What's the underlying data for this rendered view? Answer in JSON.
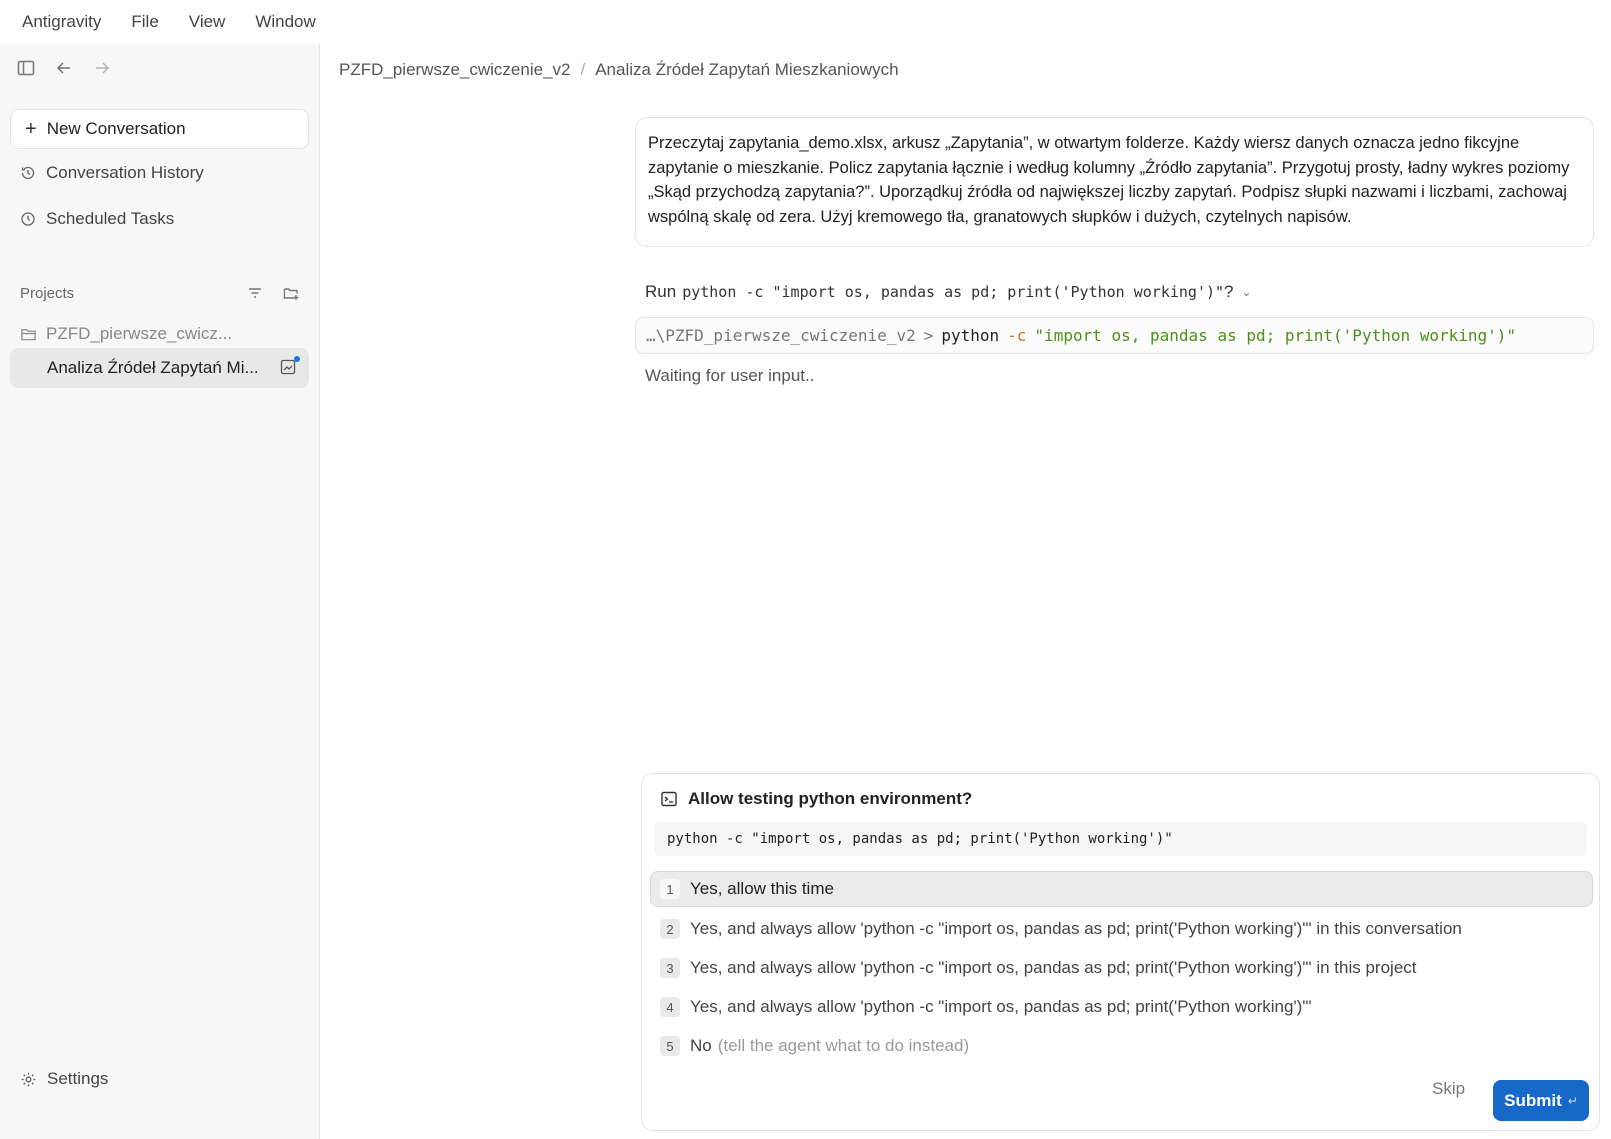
{
  "menubar": {
    "items": [
      "Antigravity",
      "File",
      "View",
      "Window"
    ]
  },
  "sidebar": {
    "toggle_icon": "sidebar-toggle-icon",
    "back_icon": "arrow-left-icon",
    "forward_icon": "arrow-right-icon",
    "new_conversation": "New Conversation",
    "links": [
      {
        "label": "Conversation History",
        "icon": "history-icon"
      },
      {
        "label": "Scheduled Tasks",
        "icon": "clock-icon"
      }
    ],
    "projects_label": "Projects",
    "project_folder": "PZFD_pierwsze_cwicz...",
    "active_conversation": "Analiza Źródeł Zapytań Mi...",
    "settings_label": "Settings"
  },
  "breadcrumb": {
    "project": "PZFD_pierwsze_cwiczenie_v2",
    "separator": "/",
    "conversation": "Analiza Źródeł Zapytań Mieszkaniowych"
  },
  "user_message": {
    "text": "Przeczytaj zapytania_demo.xlsx, arkusz „Zapytania”, w otwartym folderze. Każdy wiersz danych oznacza jedno fikcyjne zapytanie o mieszkanie. Policz zapytania łącznie i według kolumny „Źródło zapytania”. Przygotuj prosty, ładny wykres poziomy „Skąd przychodzą zapytania?”. Uporządkuj źródła od największej liczby zapytań. Podpisz słupki nazwami i liczbami, zachowaj wspólną skalę od zera. Użyj kremowego tła, granatowych słupków i dużych, czytelnych napisów."
  },
  "run_prompt": {
    "prefix": "Run",
    "command": "python -c \"import os, pandas as pd; print('Python working')\"",
    "suffix": "?"
  },
  "terminal": {
    "path": "…\\PZFD_pierwsze_cwiczenie_v2",
    "prompt": ">",
    "program": "python",
    "flag": "-c",
    "argument": "\"import os, pandas as pd; print('Python working')\""
  },
  "status": {
    "waiting": "Waiting for user input.."
  },
  "permission": {
    "icon": "terminal-icon",
    "title": "Allow testing python environment?",
    "command": "python -c \"import os, pandas as pd; print('Python working')\"",
    "options": [
      {
        "num": "1",
        "label": "Yes, allow this time",
        "hint": ""
      },
      {
        "num": "2",
        "label": "Yes, and always allow 'python -c \"import os, pandas as pd; print('Python working')\"' in this conversation",
        "hint": ""
      },
      {
        "num": "3",
        "label": "Yes, and always allow 'python -c \"import os, pandas as pd; print('Python working')\"' in this project",
        "hint": ""
      },
      {
        "num": "4",
        "label": "Yes, and always allow 'python -c \"import os, pandas as pd; print('Python working')\"'",
        "hint": ""
      },
      {
        "num": "5",
        "label": "No",
        "hint": "(tell the agent what to do instead)"
      }
    ],
    "skip_label": "Skip",
    "submit_label": "Submit",
    "submit_enter_glyph": "↵"
  },
  "colors": {
    "accent": "#1669c9",
    "sidebar_bg": "#f7f7f7",
    "terminal_string": "#4f8f1c",
    "terminal_flag": "#c7791e"
  }
}
